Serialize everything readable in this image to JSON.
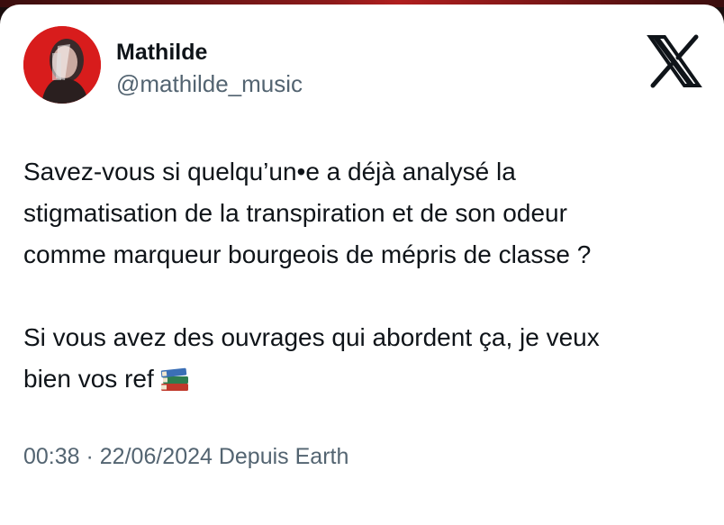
{
  "author": {
    "name": "Mathilde",
    "handle": "@mathilde_music"
  },
  "tweet": {
    "paragraph_1": "Savez-vous si quelqu’un•e a déjà analysé la\nstigmatisation de la transpiration et de son odeur\ncomme marqueur bourgeois de mépris de classe ?",
    "paragraph_2": "Si vous avez des ouvrages qui abordent ça, je veux\nbien vos ref",
    "emoji": "books-icon"
  },
  "meta": {
    "time": "00:38",
    "separator": " · ",
    "date": "22/06/2024",
    "source": " Depuis Earth"
  },
  "logo": "x-logo-icon",
  "colors": {
    "background": "#ffffff",
    "text": "#0f1419",
    "secondary": "#536471",
    "avatar_bg": "#d81c1c"
  }
}
